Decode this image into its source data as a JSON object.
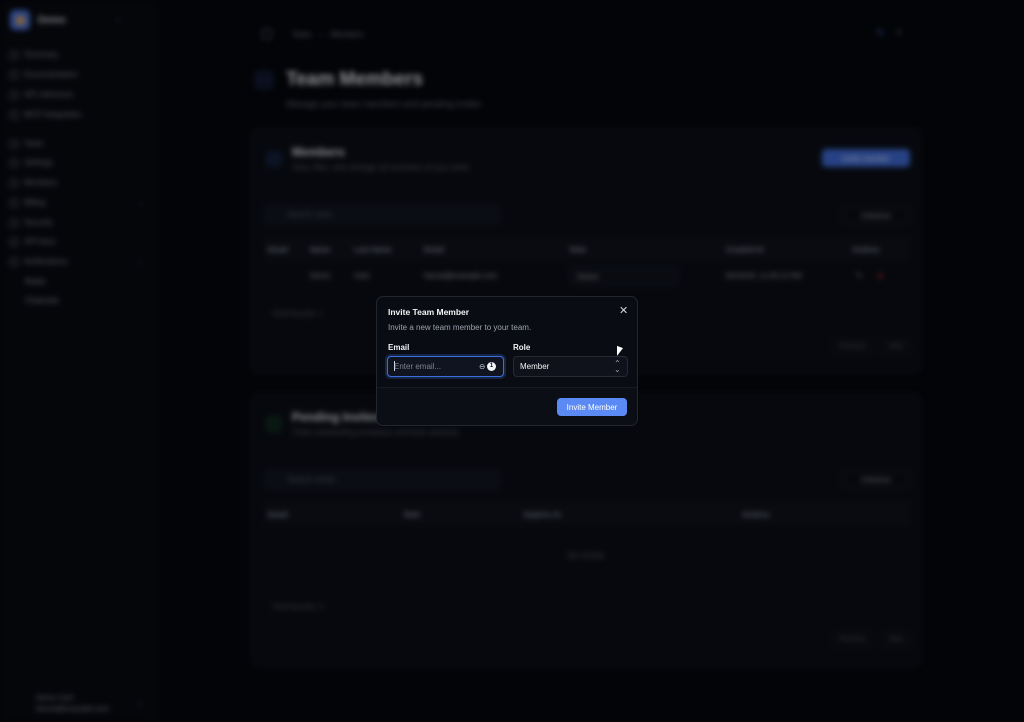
{
  "sidebar": {
    "workspace": "Demo",
    "sections": [
      {
        "label": "Summary"
      },
      {
        "label": "Documentation"
      },
      {
        "label": "API reference"
      },
      {
        "label": "MCP integration"
      }
    ],
    "items": [
      {
        "label": "Team"
      },
      {
        "label": "Settings"
      },
      {
        "label": "Members"
      },
      {
        "label": "Billing"
      },
      {
        "label": "Security"
      },
      {
        "label": "API keys"
      },
      {
        "label": "Notifications"
      }
    ],
    "sub_items": [
      {
        "label": "Rules"
      },
      {
        "label": "Channels"
      }
    ],
    "user": {
      "name": "Demo User",
      "email": "hanna@example.com"
    }
  },
  "breadcrumb": [
    "Team",
    "Members"
  ],
  "page": {
    "title": "Team Members",
    "subtitle": "Manage your team members and pending invites"
  },
  "members_card": {
    "title": "Members",
    "subtitle": "View, filter, and manage all members of your team",
    "invite_button": "Invite member",
    "search_placeholder": "Search rows...",
    "columns_button": "Columns",
    "headers": [
      "Email",
      "Name",
      "Last Name",
      "Email",
      "Role",
      "Created At",
      "Actions"
    ],
    "rows": [
      {
        "name": "Demo",
        "last_name": "User",
        "email": "hanna@example.com",
        "role": "Owner",
        "created_at": "6/2/2025, 11:26:12 PM"
      }
    ],
    "total": "Total Results: 1",
    "prev": "Previous",
    "next": "Next"
  },
  "pending_card": {
    "title": "Pending Invites",
    "subtitle": "Track outstanding invitations and their statuses",
    "search_placeholder": "Search email...",
    "columns_button": "Columns",
    "headers": [
      "Email",
      "Role",
      "Expires At",
      "Actions"
    ],
    "empty": "No results",
    "total": "Total Results: 0",
    "prev": "Previous",
    "next": "Next"
  },
  "dialog": {
    "title": "Invite Team Member",
    "description": "Invite a new team member to your team.",
    "email_label": "Email",
    "email_placeholder": "Enter email...",
    "role_label": "Role",
    "role_value": "Member",
    "submit": "Invite Member"
  },
  "colors": {
    "accent": "#5b8af5",
    "background": "#05070d"
  }
}
